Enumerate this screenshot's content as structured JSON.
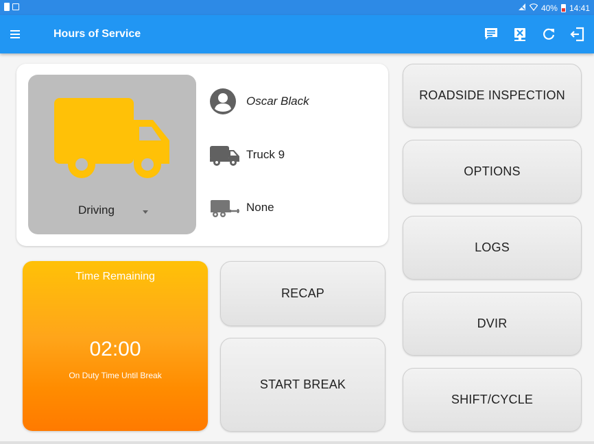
{
  "status_bar": {
    "battery": "40%",
    "time": "14:41",
    "icons": [
      "notification-icon",
      "screenshot-icon",
      "signal-muted-icon",
      "wifi-icon",
      "battery-icon"
    ]
  },
  "app_bar": {
    "title": "Hours of Service",
    "actions": [
      "message-icon",
      "device-disconnected-icon",
      "refresh-icon",
      "logout-icon"
    ]
  },
  "status": {
    "label": "Driving",
    "truck_color": "#ffc107"
  },
  "driver": {
    "name": "Oscar Black"
  },
  "vehicle": {
    "name": "Truck 9"
  },
  "trailer": {
    "name": "None"
  },
  "time_remaining": {
    "title": "Time Remaining",
    "value": "02:00",
    "subtitle": "On Duty Time Until Break"
  },
  "buttons": {
    "recap": "RECAP",
    "start_break": "START BREAK",
    "roadside": "ROADSIDE INSPECTION",
    "options": "OPTIONS",
    "logs": "LOGS",
    "dvir": "DVIR",
    "shift_cycle": "SHIFT/CYCLE"
  },
  "colors": {
    "app_bar": "#2196f3",
    "status_bar": "#2d8ae6",
    "time_gradient_top": "#ffc107",
    "time_gradient_bottom": "#ff7a00",
    "button": "#e8e8e8"
  }
}
